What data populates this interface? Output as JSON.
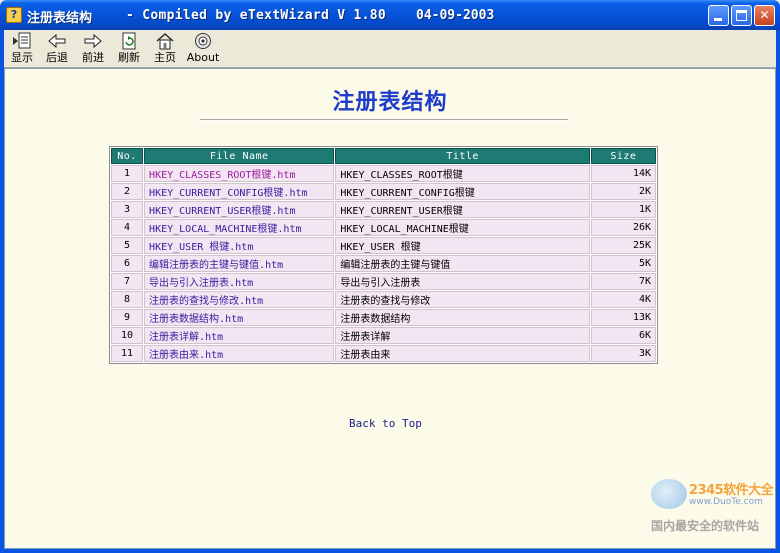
{
  "window": {
    "title": "注册表结构",
    "compiled": "- Compiled by eTextWizard V 1.80",
    "date": "04-09-2003",
    "app_icon_glyph": "?"
  },
  "toolbar": {
    "items": [
      {
        "label": "显示",
        "icon": "show-pane-icon"
      },
      {
        "label": "后退",
        "icon": "back-arrow-icon"
      },
      {
        "label": "前进",
        "icon": "forward-arrow-icon"
      },
      {
        "label": "刷新",
        "icon": "refresh-icon"
      },
      {
        "label": "主页",
        "icon": "home-icon"
      },
      {
        "label": "About",
        "icon": "about-icon"
      }
    ]
  },
  "page": {
    "heading": "注册表结构",
    "back_to_top": "Back to Top"
  },
  "table": {
    "headers": [
      "No.",
      "File Name",
      "Title",
      "Size"
    ],
    "rows": [
      {
        "no": "1",
        "file": "HKEY_CLASSES_ROOT根键.htm",
        "title": "HKEY_CLASSES_ROOT根键",
        "size": "14K"
      },
      {
        "no": "2",
        "file": "HKEY_CURRENT_CONFIG根键.htm",
        "title": "HKEY_CURRENT_CONFIG根键",
        "size": "2K"
      },
      {
        "no": "3",
        "file": "HKEY_CURRENT_USER根键.htm",
        "title": "HKEY_CURRENT_USER根键",
        "size": "1K"
      },
      {
        "no": "4",
        "file": "HKEY_LOCAL_MACHINE根键.htm",
        "title": "HKEY_LOCAL_MACHINE根键",
        "size": "26K"
      },
      {
        "no": "5",
        "file": "HKEY_USER 根键.htm",
        "title": "HKEY_USER 根键",
        "size": "25K"
      },
      {
        "no": "6",
        "file": "编辑注册表的主键与键值.htm",
        "title": "编辑注册表的主键与键值",
        "size": "5K"
      },
      {
        "no": "7",
        "file": "导出与引入注册表.htm",
        "title": "导出与引入注册表",
        "size": "7K"
      },
      {
        "no": "8",
        "file": "注册表的查找与修改.htm",
        "title": "注册表的查找与修改",
        "size": "4K"
      },
      {
        "no": "9",
        "file": "注册表数据结构.htm",
        "title": "注册表数据结构",
        "size": "13K"
      },
      {
        "no": "10",
        "file": "注册表详解.htm",
        "title": "注册表详解",
        "size": "6K"
      },
      {
        "no": "11",
        "file": "注册表由来.htm",
        "title": "注册表由来",
        "size": "3K"
      }
    ]
  },
  "watermark": {
    "brand": "2345软件大全",
    "url": "www.DuoTe.com",
    "slogan": "国内最安全的软件站"
  },
  "colors": {
    "title_bar": "#0a54e3",
    "heading": "#1d3cc9",
    "table_header": "#1e7b74",
    "row_bg": "#f3e5f1",
    "content_bg": "#fcfae8"
  }
}
